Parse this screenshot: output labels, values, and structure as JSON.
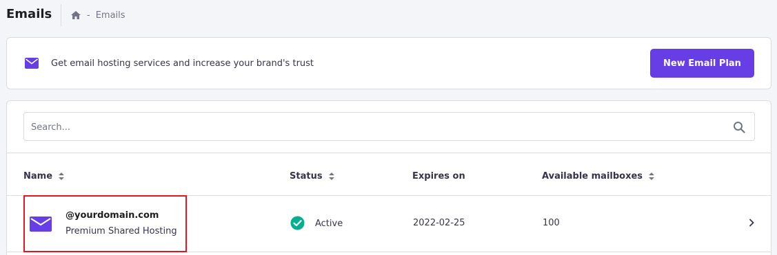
{
  "header": {
    "title": "Emails",
    "breadcrumb_separator": "-",
    "breadcrumb_current": "Emails"
  },
  "promo": {
    "text": "Get email hosting services and increase your brand's trust",
    "button_label": "New Email Plan"
  },
  "search": {
    "placeholder": "Search..."
  },
  "table": {
    "columns": {
      "name": "Name",
      "status": "Status",
      "expires": "Expires on",
      "mailboxes": "Available mailboxes"
    },
    "rows": [
      {
        "domain": "@yourdomain.com",
        "plan": "Premium Shared Hosting",
        "status": "Active",
        "expires": "2022-02-25",
        "mailboxes": "100"
      }
    ]
  },
  "colors": {
    "accent": "#673de6",
    "status_active": "#00b090",
    "highlight": "#e4151f"
  },
  "icons": [
    "home-icon",
    "mail-icon",
    "search-icon",
    "sort-icon",
    "check-circle-icon",
    "chevron-right-icon"
  ]
}
